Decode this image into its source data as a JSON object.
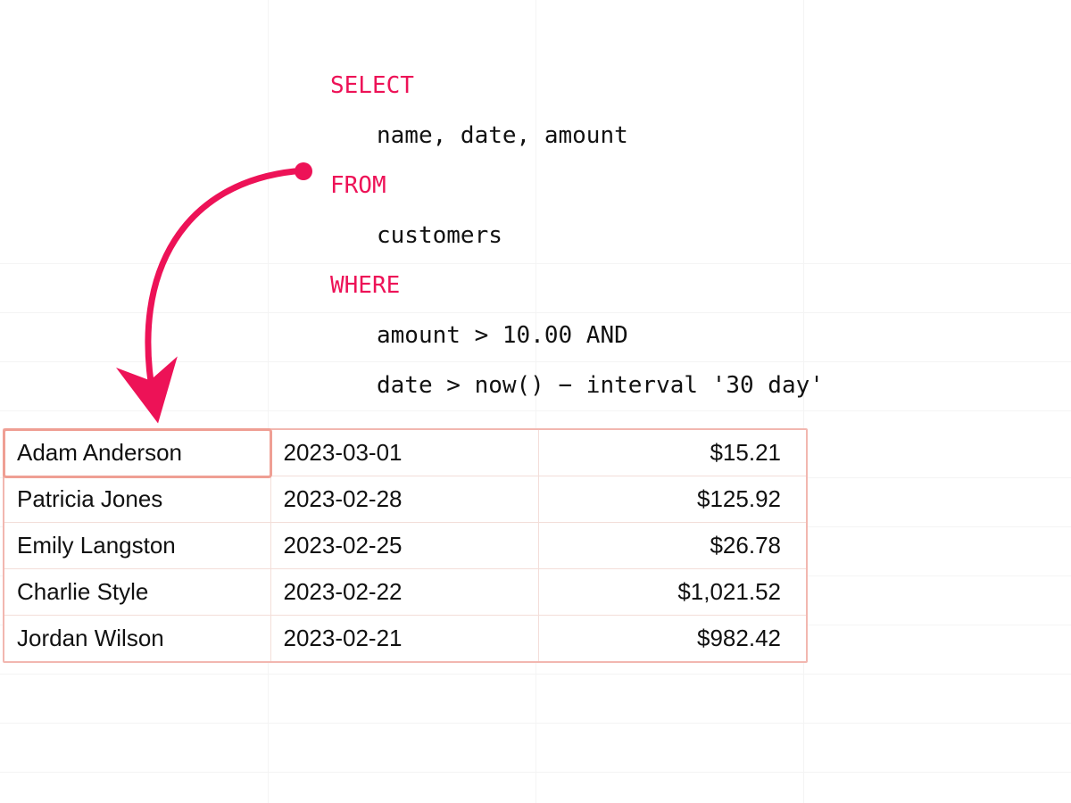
{
  "colors": {
    "accent": "#ed1257",
    "tableBorder": "#f2b7b0",
    "cellHighlight": "#ef9f94"
  },
  "sql": {
    "select_kw": "SELECT",
    "select_cols": "name, date, amount",
    "from_kw": "FROM",
    "from_table": "customers",
    "where_kw": "WHERE",
    "where_c1": "amount > 10.00 AND",
    "where_c2": "date > now() − interval '30 day'"
  },
  "results": {
    "rows": [
      {
        "name": "Adam Anderson",
        "date": "2023-03-01",
        "amount": "$15.21"
      },
      {
        "name": "Patricia Jones",
        "date": "2023-02-28",
        "amount": "$125.92"
      },
      {
        "name": "Emily Langston",
        "date": "2023-02-25",
        "amount": "$26.78"
      },
      {
        "name": "Charlie Style",
        "date": "2023-02-22",
        "amount": "$1,021.52"
      },
      {
        "name": "Jordan Wilson",
        "date": "2023-02-21",
        "amount": "$982.42"
      }
    ]
  }
}
